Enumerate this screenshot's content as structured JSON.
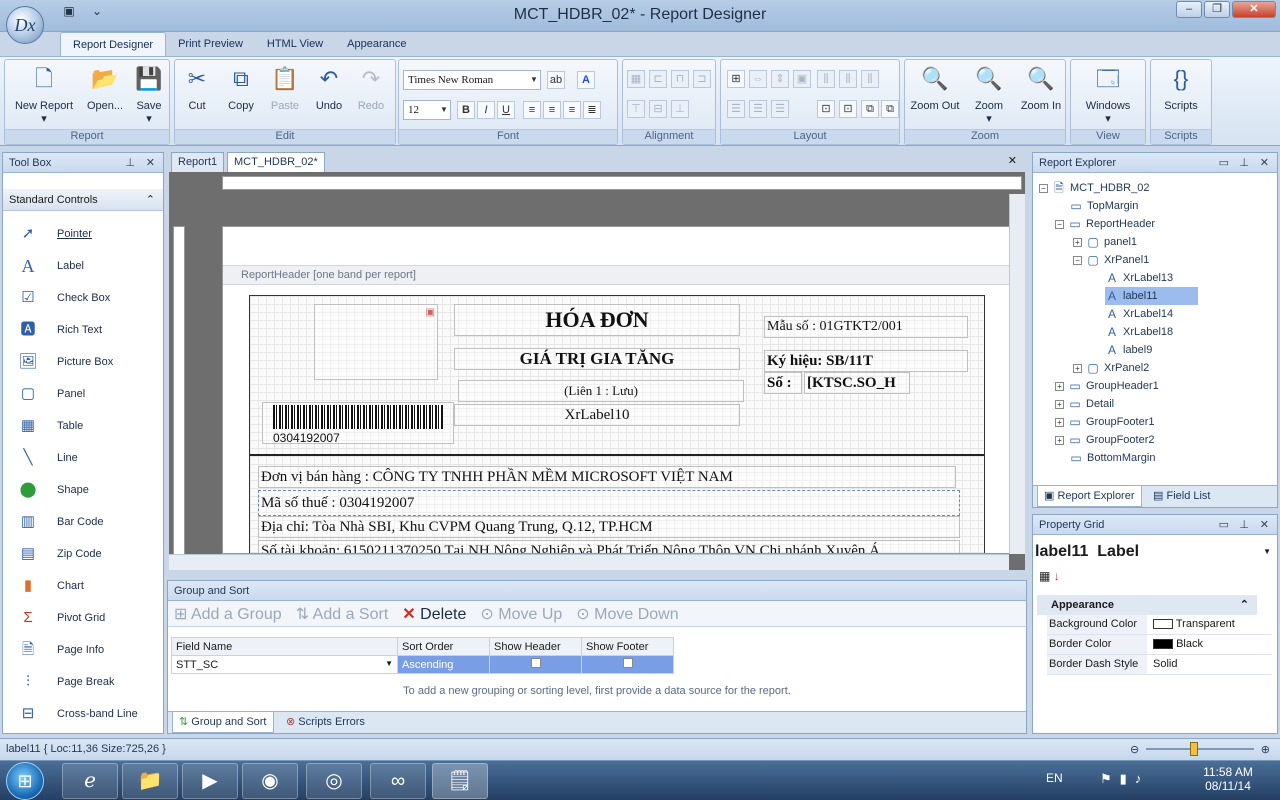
{
  "window": {
    "title": "MCT_HDBR_02* - Report Designer",
    "logo": "Dx"
  },
  "ribbon_tabs": [
    "Report Designer",
    "Print Preview",
    "HTML View",
    "Appearance"
  ],
  "ribbon": {
    "report": {
      "label": "Report",
      "new": "New Report",
      "open": "Open...",
      "save": "Save"
    },
    "edit": {
      "label": "Edit",
      "cut": "Cut",
      "copy": "Copy",
      "paste": "Paste",
      "undo": "Undo",
      "redo": "Redo"
    },
    "font": {
      "label": "Font",
      "name": "Times New Roman",
      "size": "12"
    },
    "alignment": {
      "label": "Alignment"
    },
    "layout": {
      "label": "Layout"
    },
    "zoom": {
      "label": "Zoom",
      "out": "Zoom Out",
      "zoom": "Zoom",
      "in": "Zoom In"
    },
    "view": {
      "label": "View",
      "windows": "Windows"
    },
    "scripts": {
      "label": "Scripts",
      "scripts": "Scripts"
    }
  },
  "toolbox": {
    "title": "Tool Box",
    "section": "Standard Controls",
    "items": [
      "Pointer",
      "Label",
      "Check Box",
      "Rich Text",
      "Picture Box",
      "Panel",
      "Table",
      "Line",
      "Shape",
      "Bar Code",
      "Zip Code",
      "Chart",
      "Pivot Grid",
      "Page Info",
      "Page Break",
      "Cross-band Line"
    ]
  },
  "doc_tabs": [
    "Report1",
    "MCT_HDBR_02*"
  ],
  "report": {
    "band": "ReportHeader [one band per report]",
    "title": "HÓA ĐƠN",
    "subtitle": "GIÁ TRỊ GIA TĂNG",
    "lien": "(Liên 1 : Lưu)",
    "xrlabel10": "XrLabel10",
    "mau_so": "Mẫu số : 01GTKT2/001",
    "ky_hieu": "Ký hiệu: SB/11T",
    "so_label": "Số :",
    "so_value": "[KTSC.SO_H",
    "barcode_text": "0304192007",
    "seller": "Đơn vị bán hàng : CÔNG TY TNHH PHẦN MỀM MICROSOFT VIỆT NAM",
    "tax": "Mã số thuế : 0304192007",
    "address": "Địa chỉ: Tòa Nhà SBI, Khu CVPM Quang Trung, Q.12, TP.HCM",
    "account": "Số tài khoản: 6150211370250 Tại NH Nông Nghiệp và Phát Triển Nông Thôn VN Chi nhánh Xuyên Á"
  },
  "group_sort": {
    "title": "Group and Sort",
    "add_group": "Add a Group",
    "add_sort": "Add a Sort",
    "delete": "Delete",
    "move_up": "Move Up",
    "move_down": "Move Down",
    "columns": [
      "Field Name",
      "Sort Order",
      "Show Header",
      "Show Footer"
    ],
    "row": {
      "field": "STT_SC",
      "order": "Ascending"
    },
    "hint": "To add a new grouping or sorting level, first provide a data source for the report.",
    "tabs": [
      "Group and Sort",
      "Scripts Errors"
    ]
  },
  "explorer": {
    "title": "Report Explorer",
    "nodes": [
      "MCT_HDBR_02",
      "TopMargin",
      "ReportHeader",
      "panel1",
      "XrPanel1",
      "XrLabel13",
      "label11",
      "XrLabel14",
      "XrLabel18",
      "label9",
      "XrPanel2",
      "GroupHeader1",
      "Detail",
      "GroupFooter1",
      "GroupFooter2",
      "BottomMargin"
    ],
    "tabs": [
      "Report Explorer",
      "Field List"
    ]
  },
  "property_grid": {
    "title": "Property Grid",
    "object": "label11",
    "type": "Label",
    "category": "Appearance",
    "rows": [
      {
        "k": "Background Color",
        "v": "Transparent"
      },
      {
        "k": "Border Color",
        "v": "Black"
      },
      {
        "k": "Border Dash Style",
        "v": "Solid"
      }
    ]
  },
  "status": "label11 { Loc:11,36 Size:725,26 }",
  "tray": {
    "lang": "EN",
    "time": "11:58 AM",
    "date": "08/11/14"
  }
}
